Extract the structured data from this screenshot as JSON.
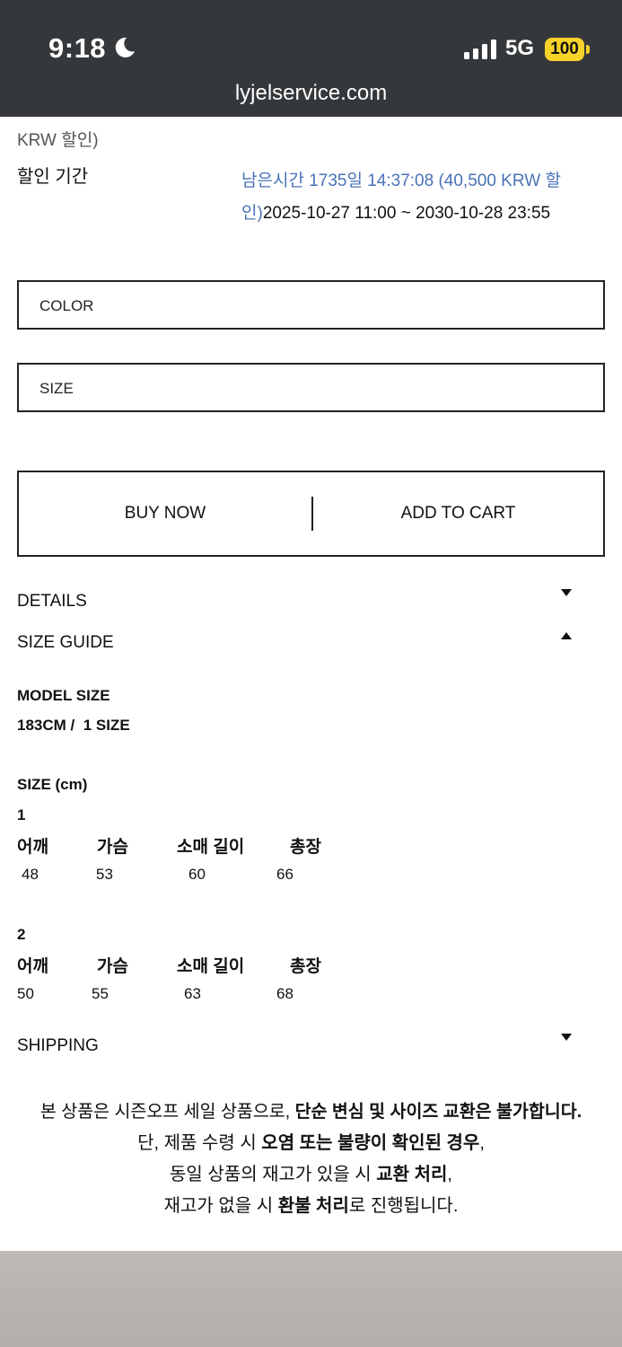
{
  "status_bar": {
    "time": "9:18",
    "network": "5G",
    "battery": "100",
    "url": "lyjelservice.com"
  },
  "discount": {
    "prev_line_tail": "KRW 할인)",
    "period_label": "할인 기간",
    "remaining_line1": "남은시간 1735일 14:37:08 (40,500 KRW 할",
    "remaining_line2": "인)",
    "period_range": "2025-10-27 11:00 ~ 2030-10-28 23:55"
  },
  "options": {
    "color_label": "COLOR",
    "size_label": "SIZE"
  },
  "actions": {
    "buy_now": "BUY NOW",
    "add_to_cart": "ADD TO CART"
  },
  "accordion": {
    "details": "DETAILS",
    "size_guide": "SIZE GUIDE",
    "shipping": "SHIPPING"
  },
  "size_guide": {
    "model_size_title": "MODEL SIZE",
    "model_size_value": "183CM /  1 SIZE",
    "size_title": "SIZE (cm)",
    "columns": [
      "어깨",
      "가슴",
      "소매 길이",
      "총장"
    ],
    "sizes": [
      {
        "name": "1",
        "values": [
          "48",
          "53",
          "60",
          "66"
        ]
      },
      {
        "name": "2",
        "values": [
          "50",
          "55",
          "63",
          "68"
        ]
      }
    ]
  },
  "notice": {
    "l1_a": "본 상품은 시즌오프 세일 상품으로, ",
    "l1_b": "단순 변심 및 사이즈 교환은 불가합니다.",
    "l2_a": "단, 제품 수령 시 ",
    "l2_b": "오염 또는 불량이 확인된 경우",
    "l2_c": ",",
    "l3_a": "동일 상품의 재고가 있을 시 ",
    "l3_b": "교환 처리",
    "l3_c": ",",
    "l4_a": "재고가 없을 시 ",
    "l4_b": "환불 처리",
    "l4_c": "로 진행됩니다."
  },
  "colors": {
    "status_bg": "#35383b",
    "battery": "#f7d229",
    "accent_blue": "#4a72b8"
  }
}
